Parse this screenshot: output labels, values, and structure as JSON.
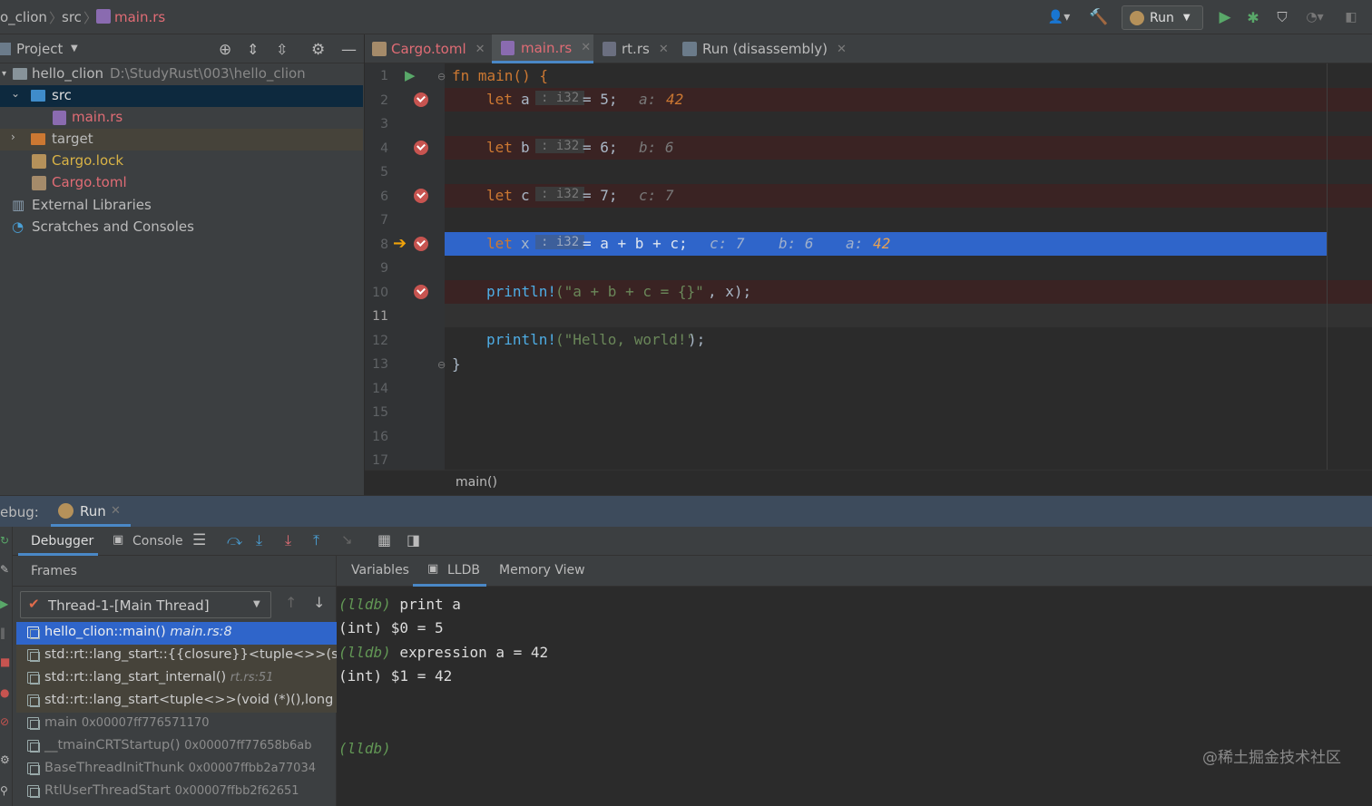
{
  "breadcrumb": {
    "project": "o_clion",
    "folder": "src",
    "file": "main.rs"
  },
  "toolbar": {
    "run_config": "Run"
  },
  "project_panel": {
    "title": "Project",
    "tree": [
      {
        "label": "hello_clion",
        "path": "D:\\StudyRust\\003\\hello_clion"
      },
      {
        "label": "src"
      },
      {
        "label": "main.rs"
      },
      {
        "label": "target"
      },
      {
        "label": "Cargo.lock"
      },
      {
        "label": "Cargo.toml"
      },
      {
        "label": "External Libraries"
      },
      {
        "label": "Scratches and Consoles"
      }
    ]
  },
  "editor": {
    "tabs": [
      "Cargo.toml",
      "main.rs",
      "rt.rs",
      "Run (disassembly)"
    ],
    "line_numbers": [
      "1",
      "2",
      "3",
      "4",
      "5",
      "6",
      "7",
      "8",
      "9",
      "10",
      "11",
      "12",
      "13",
      "14",
      "15",
      "16",
      "17"
    ],
    "lines": {
      "l1": "fn main() {",
      "l2_kw": "let",
      "l2_var": "a",
      "l2_type": ": i32",
      "l2_rest": "= 5;",
      "l2_inline": "a: ",
      "l2_inline_val": "42",
      "l4_kw": "let",
      "l4_var": "b",
      "l4_type": ": i32",
      "l4_rest": "= 6;",
      "l4_inline": "b: 6",
      "l6_kw": "let",
      "l6_var": "c",
      "l6_type": ": i32",
      "l6_rest": "= 7;",
      "l6_inline": "c: 7",
      "l8_kw": "let",
      "l8_var": "x",
      "l8_type": ": i32",
      "l8_rest": "= a + b + c;",
      "l8_inline_c": "c: 7",
      "l8_inline_b": "b: 6",
      "l8_inline_a": "a: ",
      "l8_inline_a_val": "42",
      "l10_macro": "println!",
      "l10_str": "(\"a + b + c = {}\"",
      "l10_rest": ", x);",
      "l12_macro": "println!",
      "l12_str": "(\"Hello, world!\"",
      "l12_rest": ");",
      "l13": "}"
    },
    "breadcrumb": "main()"
  },
  "debug": {
    "label": "ebug:",
    "run_tab": "Run",
    "tabs": {
      "debugger": "Debugger",
      "console": "Console"
    },
    "frames_title": "Frames",
    "thread": "Thread-1-[Main Thread]",
    "frames": [
      {
        "name": "hello_clion::main()",
        "loc": "main.rs:8"
      },
      {
        "name": "std::rt::lang_start::{{closure}}<tuple<>>(std::rt",
        "loc": ""
      },
      {
        "name": "std::rt::lang_start_internal()",
        "loc": "rt.rs:51"
      },
      {
        "name": "std::rt::lang_start<tuple<>>(void (*)(),long lor",
        "loc": ""
      },
      {
        "name": "main",
        "loc": "0x00007ff776571170"
      },
      {
        "name": "__tmainCRTStartup()",
        "loc": "0x00007ff77658b6ab"
      },
      {
        "name": "BaseThreadInitThunk",
        "loc": "0x00007ffbb2a77034"
      },
      {
        "name": "RtlUserThreadStart",
        "loc": "0x00007ffbb2f62651"
      }
    ],
    "subtabs": {
      "variables": "Variables",
      "lldb": "LLDB",
      "memory": "Memory View"
    },
    "console_lines": [
      {
        "prompt": "(lldb)",
        "text": " print a"
      },
      {
        "prompt": "",
        "text": "(int) $0 = 5"
      },
      {
        "prompt": "(lldb)",
        "text": " expression a = 42"
      },
      {
        "prompt": "",
        "text": "(int) $1 = 42"
      },
      {
        "prompt": "(lldb)",
        "text": ""
      }
    ],
    "watermark": "@稀土掘金技术社区"
  },
  "colors": {
    "keyword": "#cc7832",
    "string": "#6a8759",
    "macro": "#4eade5",
    "hint_value": "#cc7832",
    "selection": "#2f65ca",
    "breakpoint": "#c75450",
    "lldb_prompt": "#629755"
  }
}
